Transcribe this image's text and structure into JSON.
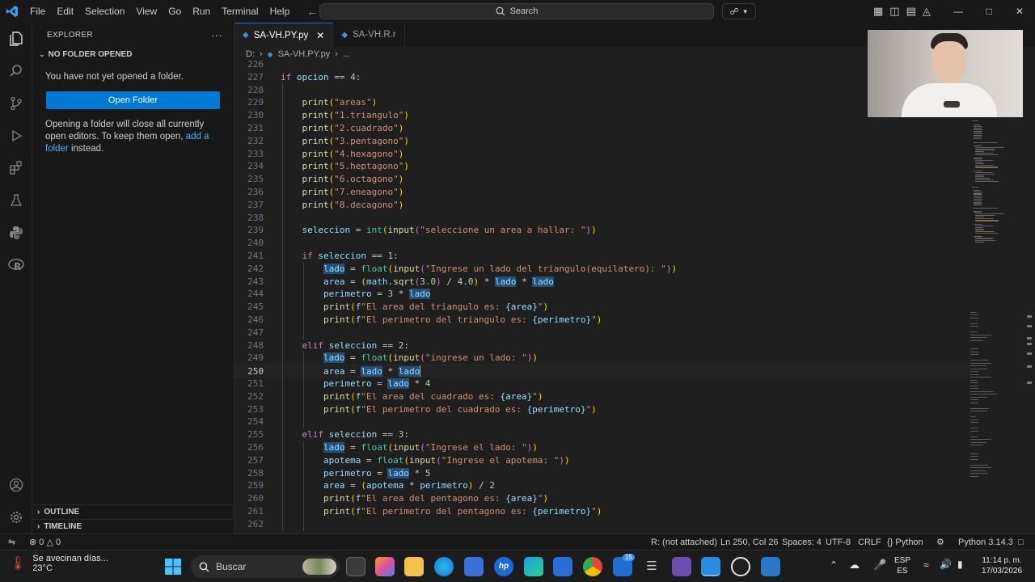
{
  "titlebar": {
    "menu": [
      "File",
      "Edit",
      "Selection",
      "View",
      "Go",
      "Run",
      "Terminal",
      "Help"
    ],
    "search_placeholder": "Search"
  },
  "sidebar": {
    "title": "EXPLORER",
    "section": "NO FOLDER OPENED",
    "message": "You have not yet opened a folder.",
    "open_button": "Open Folder",
    "hint_prefix": "Opening a folder will close all currently open editors. To keep them open,",
    "hint_link": "add a folder",
    "hint_suffix": "instead.",
    "outline": "OUTLINE",
    "timeline": "TIMELINE"
  },
  "tabs": [
    {
      "label": "SA-VH.PY.py",
      "active": true
    },
    {
      "label": "SA-VH.R.r",
      "active": false
    }
  ],
  "breadcrumb": {
    "drive": "D:",
    "file": "SA-VH.PY.py",
    "more": "..."
  },
  "editor": {
    "current_line": 250,
    "lines": [
      {
        "n": 226,
        "t": ""
      },
      {
        "n": 227,
        "t": "if opcion == 4:"
      },
      {
        "n": 228,
        "t": ""
      },
      {
        "n": 229,
        "t": "    print(\"areas\")"
      },
      {
        "n": 230,
        "t": "    print(\"1.triangulo\")"
      },
      {
        "n": 231,
        "t": "    print(\"2.cuadrado\")"
      },
      {
        "n": 232,
        "t": "    print(\"3.pentagono\")"
      },
      {
        "n": 233,
        "t": "    print(\"4.hexagono\")"
      },
      {
        "n": 234,
        "t": "    print(\"5.heptagono\")"
      },
      {
        "n": 235,
        "t": "    print(\"6.octagono\")"
      },
      {
        "n": 236,
        "t": "    print(\"7.eneagono\")"
      },
      {
        "n": 237,
        "t": "    print(\"8.decagono\")"
      },
      {
        "n": 238,
        "t": ""
      },
      {
        "n": 239,
        "t": "    seleccion = int(input(\"seleccione un area a hallar: \"))"
      },
      {
        "n": 240,
        "t": ""
      },
      {
        "n": 241,
        "t": "    if seleccion == 1:"
      },
      {
        "n": 242,
        "t": "        lado = float(input(\"Ingrese un lado del triangulo(equilatero): \"))"
      },
      {
        "n": 243,
        "t": "        area = (math.sqrt(3.0) / 4.0) * lado * lado"
      },
      {
        "n": 244,
        "t": "        perimetro = 3 * lado"
      },
      {
        "n": 245,
        "t": "        print(f\"El area del triangulo es: {area}\")"
      },
      {
        "n": 246,
        "t": "        print(f\"El perimetro del triangulo es: {perimetro}\")"
      },
      {
        "n": 247,
        "t": ""
      },
      {
        "n": 248,
        "t": "    elif seleccion == 2:"
      },
      {
        "n": 249,
        "t": "        lado = float(input(\"ingrese un lado: \"))"
      },
      {
        "n": 250,
        "t": "        area = lado * lado"
      },
      {
        "n": 251,
        "t": "        perimetro = lado * 4"
      },
      {
        "n": 252,
        "t": "        print(f\"El area del cuadrado es: {area}\")"
      },
      {
        "n": 253,
        "t": "        print(f\"El perimetro del cuadrado es: {perimetro}\")"
      },
      {
        "n": 254,
        "t": ""
      },
      {
        "n": 255,
        "t": "    elif seleccion == 3:"
      },
      {
        "n": 256,
        "t": "        lado = float(input(\"Ingrese el lado: \"))"
      },
      {
        "n": 257,
        "t": "        apotema = float(input(\"Ingrese el apotema: \"))"
      },
      {
        "n": 258,
        "t": "        perimetro = lado * 5"
      },
      {
        "n": 259,
        "t": "        area = (apotema * perimetro) / 2"
      },
      {
        "n": 260,
        "t": "        print(f\"El area del pentagono es: {area}\")"
      },
      {
        "n": 261,
        "t": "        print(f\"El perimetro del pentagono es: {perimetro}\")"
      },
      {
        "n": 262,
        "t": ""
      }
    ]
  },
  "statusbar": {
    "errors": "0",
    "warnings": "0",
    "r_status": "R: (not attached)",
    "position": "Ln 250, Col 26",
    "spaces": "Spaces: 4",
    "encoding": "UTF-8",
    "eol": "CRLF",
    "language": "Python",
    "interpreter": "Python 3.14.3"
  },
  "taskbar": {
    "weather_text": "Se avecinan días...",
    "weather_temp": "23°C",
    "search": "Buscar",
    "lang_top": "ESP",
    "lang_bottom": "ES",
    "time": "11:14 p. m.",
    "date": "17/03/2026",
    "badge": "15"
  },
  "colors": {
    "accent": "#0078d4",
    "keyword": "#c586c0",
    "function": "#dcdcaa",
    "string": "#ce9178",
    "variable": "#9cdcfe",
    "number": "#b5cea8"
  }
}
